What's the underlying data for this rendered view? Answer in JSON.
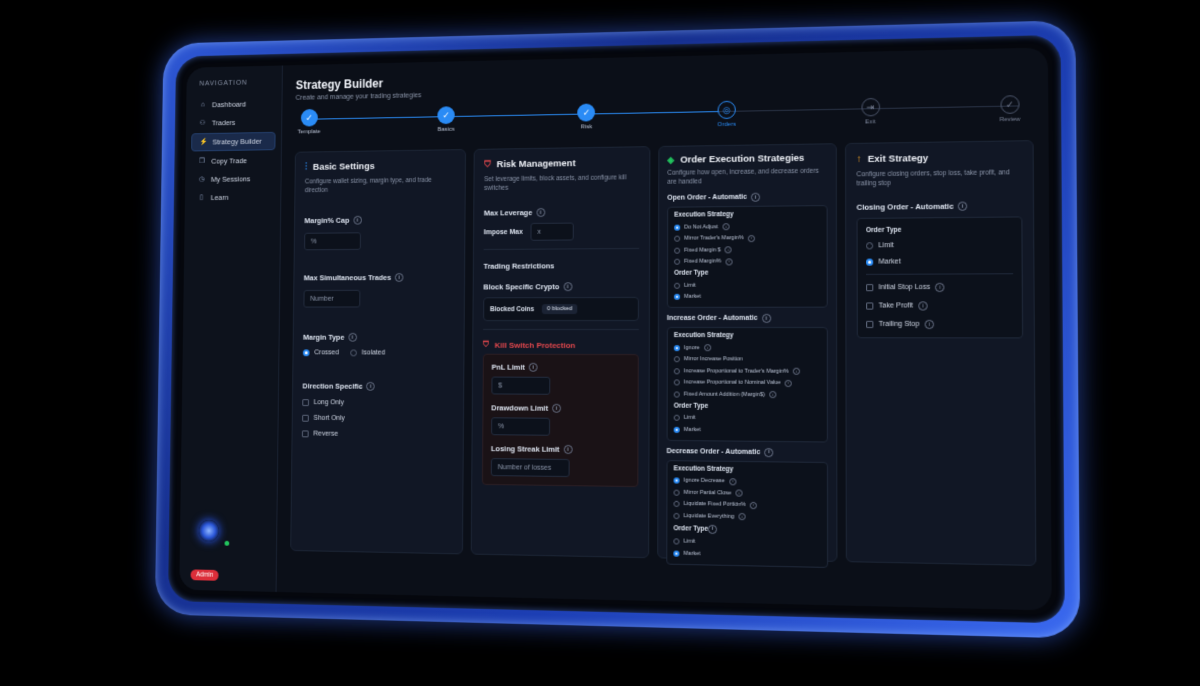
{
  "sidebar": {
    "heading": "NAVIGATION",
    "items": [
      {
        "label": "Dashboard",
        "icon": "home-icon"
      },
      {
        "label": "Traders",
        "icon": "users-icon"
      },
      {
        "label": "Strategy Builder",
        "icon": "wand-icon"
      },
      {
        "label": "Copy Trade",
        "icon": "copy-icon"
      },
      {
        "label": "My Sessions",
        "icon": "clock-icon"
      },
      {
        "label": "Learn",
        "icon": "book-icon"
      }
    ],
    "active_item": "Strategy Builder",
    "badge": "Admin"
  },
  "header": {
    "title": "Strategy Builder",
    "subtitle": "Create and manage your trading strategies"
  },
  "stepper": {
    "steps": [
      "Template",
      "Basics",
      "Risk",
      "Orders",
      "Exit",
      "Review"
    ],
    "current": "Orders",
    "accent": "#2a8bf5"
  },
  "basic": {
    "title": "Basic Settings",
    "desc": "Configure wallet sizing, margin type, and trade direction",
    "margin_cap_label": "Margin% Cap",
    "margin_cap_placeholder": "%",
    "max_trades_label": "Max Simultaneous Trades",
    "max_trades_placeholder": "Number",
    "margin_type_label": "Margin Type",
    "margin_type_options": [
      "Crossed",
      "Isolated"
    ],
    "margin_type_selected": "Crossed",
    "direction_label": "Direction Specific",
    "direction_options": [
      "Long Only",
      "Short Only",
      "Reverse"
    ]
  },
  "risk": {
    "title": "Risk Management",
    "desc": "Set leverage limits, block assets, and configure kill switches",
    "max_leverage_label": "Max Leverage",
    "impose_max_label": "Impose Max",
    "impose_max_placeholder": "x",
    "trading_restrictions_label": "Trading Restrictions",
    "block_crypto_label": "Block Specific Crypto",
    "blocked_coins_label": "Blocked Coins",
    "blocked_coins_value": "0 blocked",
    "kill_switch_title": "Kill Switch Protection",
    "kill_switch_color": "#e5484d",
    "pnl_limit_label": "PnL Limit",
    "pnl_limit_placeholder": "$",
    "drawdown_limit_label": "Drawdown Limit",
    "drawdown_limit_placeholder": "%",
    "losing_streak_label": "Losing Streak Limit",
    "losing_streak_placeholder": "Number of losses"
  },
  "orders": {
    "title": "Order Execution Strategies",
    "desc": "Configure how open, increase, and decrease orders are handled",
    "open": {
      "label": "Open Order - Automatic",
      "exec_label": "Execution Strategy",
      "exec_options": [
        "Do Not Adjust",
        "Mirror Trader's Margin%",
        "Fixed Margin $",
        "Fixed Margin%"
      ],
      "exec_selected": "Do Not Adjust",
      "type_label": "Order Type",
      "type_options": [
        "Limit",
        "Market"
      ],
      "type_selected": "Market"
    },
    "increase": {
      "label": "Increase Order - Automatic",
      "exec_label": "Execution Strategy",
      "exec_options": [
        "Ignore",
        "Mirror Increase Position",
        "Increase Proportional to Trader's Margin%",
        "Increase Proportional to Nominal Value",
        "Fixed Amount Addition (Margin$)"
      ],
      "exec_selected": "Ignore",
      "type_label": "Order Type",
      "type_options": [
        "Limit",
        "Market"
      ],
      "type_selected": "Market"
    },
    "decrease": {
      "label": "Decrease Order - Automatic",
      "exec_label": "Execution Strategy",
      "exec_options": [
        "Ignore Decrease",
        "Mirror Partial Close",
        "Liquidate Fixed Portion%",
        "Liquidate Everything"
      ],
      "exec_selected": "Ignore Decrease",
      "type_label": "Order Type",
      "type_options": [
        "Limit",
        "Market"
      ],
      "type_selected": "Market"
    }
  },
  "exit": {
    "title": "Exit Strategy",
    "desc": "Configure closing orders, stop loss, take profit, and trailing stop",
    "closing_label": "Closing Order - Automatic",
    "type_label": "Order Type",
    "type_options": [
      "Limit",
      "Market"
    ],
    "type_selected": "Market",
    "checks": [
      "Initial Stop Loss",
      "Take Profit",
      "Trailing Stop"
    ]
  }
}
